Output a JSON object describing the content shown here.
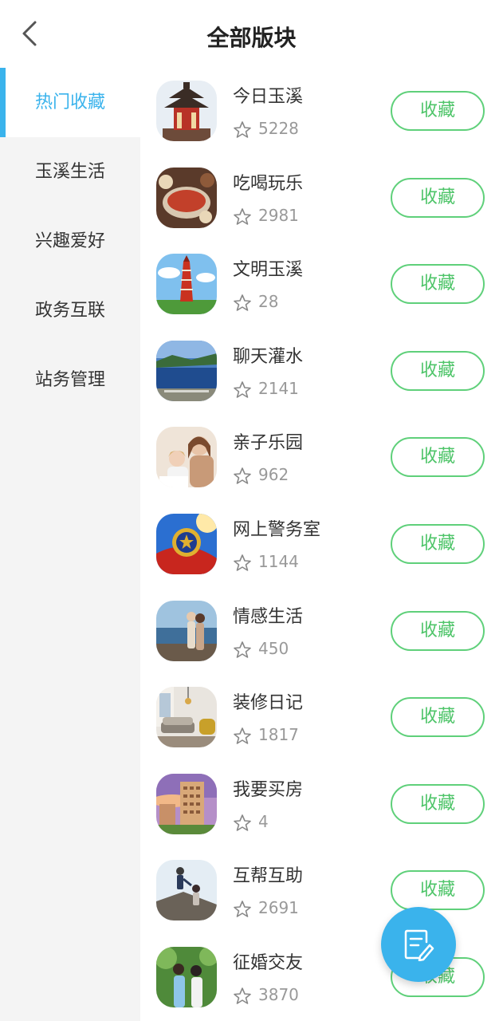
{
  "header": {
    "title": "全部版块"
  },
  "sidebar": {
    "items": [
      {
        "label": "热门收藏",
        "active": true
      },
      {
        "label": "玉溪生活"
      },
      {
        "label": "兴趣爱好"
      },
      {
        "label": "政务互联"
      },
      {
        "label": "站务管理"
      }
    ]
  },
  "forums": [
    {
      "name": "今日玉溪",
      "count": "5228",
      "button": "收藏"
    },
    {
      "name": "吃喝玩乐",
      "count": "2981",
      "button": "收藏"
    },
    {
      "name": "文明玉溪",
      "count": "28",
      "button": "收藏"
    },
    {
      "name": "聊天灌水",
      "count": "2141",
      "button": "收藏"
    },
    {
      "name": "亲子乐园",
      "count": "962",
      "button": "收藏"
    },
    {
      "name": "网上警务室",
      "count": "1144",
      "button": "收藏"
    },
    {
      "name": "情感生活",
      "count": "450",
      "button": "收藏"
    },
    {
      "name": "装修日记",
      "count": "1817",
      "button": "收藏"
    },
    {
      "name": "我要买房",
      "count": "4",
      "button": "收藏"
    },
    {
      "name": "互帮互助",
      "count": "2691",
      "button": "收藏"
    },
    {
      "name": "征婚交友",
      "count": "3870",
      "button": "收藏"
    }
  ],
  "colors": {
    "accent": "#3ab3ec",
    "favorite": "#4dc468"
  },
  "icons": {
    "back": "chevron-left-icon",
    "star": "star-outline-icon",
    "fab": "edit-note-icon"
  }
}
